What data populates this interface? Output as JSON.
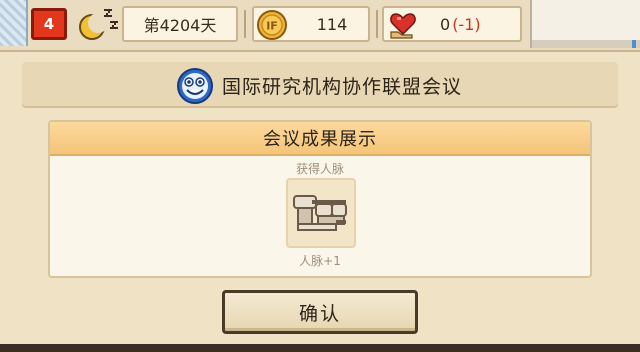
{
  "status_bar": {
    "month": "4",
    "day": "第4204天",
    "coins": "114",
    "hearts": "0",
    "hearts_delta": "(-1)",
    "colors": {
      "month_badge": "#e2361d",
      "delta": "#d2321c"
    }
  },
  "icons": {
    "moon": "moon-zzz-icon",
    "coin": "if-coin-icon",
    "heart": "heart-hand-icon",
    "banner": "smiley-face-icon",
    "reward": "connections-icon"
  },
  "banner": {
    "title": "国际研究机构协作联盟会议"
  },
  "panel": {
    "title": "会议成果展示",
    "gain_label": "获得人脉",
    "reward_caption": "人脉+1"
  },
  "confirm_button": {
    "label": "确认"
  }
}
